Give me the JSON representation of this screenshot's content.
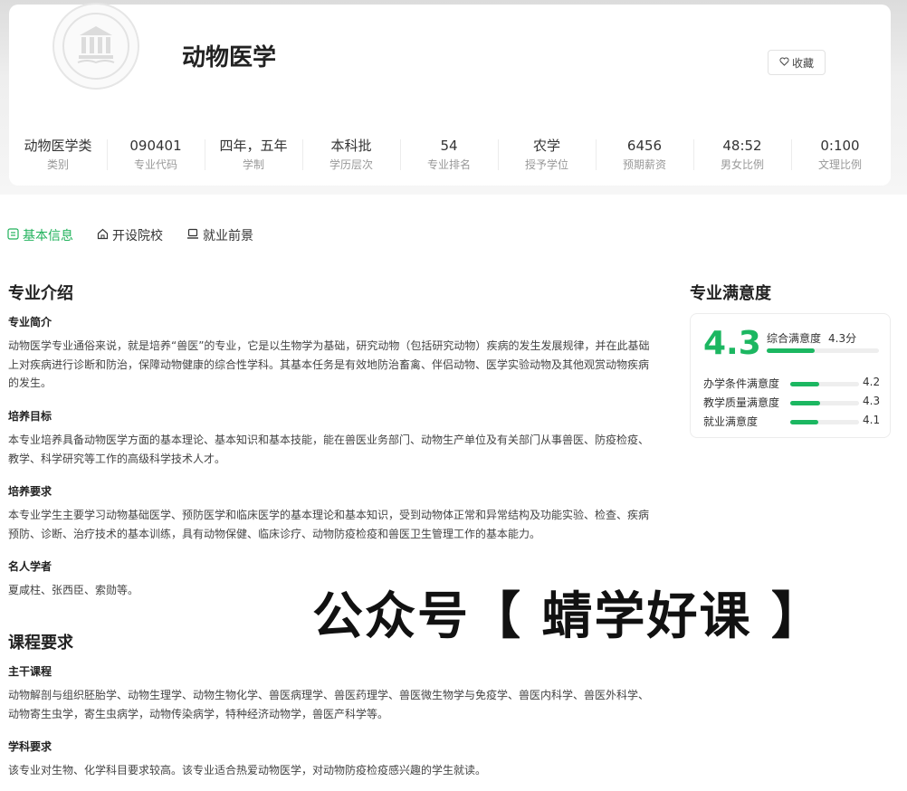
{
  "header": {
    "title": "动物医学",
    "favorite_label": "收藏"
  },
  "stats": [
    {
      "value": "动物医学类",
      "label": "类别"
    },
    {
      "value": "090401",
      "label": "专业代码"
    },
    {
      "value": "四年，五年",
      "label": "学制"
    },
    {
      "value": "本科批",
      "label": "学历层次"
    },
    {
      "value": "54",
      "label": "专业排名"
    },
    {
      "value": "农学",
      "label": "授予学位"
    },
    {
      "value": "6456",
      "label": "预期薪资"
    },
    {
      "value": "48:52",
      "label": "男女比例"
    },
    {
      "value": "0:100",
      "label": "文理比例"
    }
  ],
  "tabs": [
    {
      "label": "基本信息",
      "icon": "document-icon",
      "active": true
    },
    {
      "label": "开设院校",
      "icon": "house-icon",
      "active": false
    },
    {
      "label": "就业前景",
      "icon": "laptop-icon",
      "active": false
    }
  ],
  "intro": {
    "title": "专业介绍",
    "summary_title": "专业简介",
    "summary_text": "动物医学专业通俗来说，就是培养“兽医”的专业，它是以生物学为基础，研究动物（包括研究动物）疾病的发生发展规律，并在此基础上对疾病进行诊断和防治，保障动物健康的综合性学科。其基本任务是有效地防治畜禽、伴侣动物、医学实验动物及其他观赏动物疾病的发生。",
    "goal_title": "培养目标",
    "goal_text": "本专业培养具备动物医学方面的基本理论、基本知识和基本技能，能在兽医业务部门、动物生产单位及有关部门从事兽医、防疫检疫、教学、科学研究等工作的高级科学技术人才。",
    "req_title": "培养要求",
    "req_text": "本专业学生主要学习动物基础医学、预防医学和临床医学的基本理论和基本知识，受到动物体正常和异常结构及功能实验、检查、疾病预防、诊断、治疗技术的基本训练，具有动物保健、临床诊疗、动物防疫检疫和兽医卫生管理工作的基本能力。",
    "scholars_title": "名人学者",
    "scholars_text": "夏咸柱、张西臣、索勋等。"
  },
  "courses": {
    "title": "课程要求",
    "main_title": "主干课程",
    "main_text": "动物解剖与组织胚胎学、动物生理学、动物生物化学、兽医病理学、兽医药理学、兽医微生物学与免疫学、兽医内科学、兽医外科学、动物寄生虫学，寄生虫病学，动物传染病学，特种经济动物学，兽医产科学等。",
    "subject_title": "学科要求",
    "subject_text": "该专业对生物、化学科目要求较高。该专业适合热爱动物医学，对动物防疫检疫感兴趣的学生就读。"
  },
  "satisfaction": {
    "title": "专业满意度",
    "overall": "4.3",
    "overall_label": "综合满意度",
    "overall_score": "4.3分",
    "overall_fraction": 0.43,
    "accent_color": "#1cb761",
    "rows": [
      {
        "label": "办学条件满意度",
        "value": "4.2",
        "fraction": 0.42
      },
      {
        "label": "教学质量满意度",
        "value": "4.3",
        "fraction": 0.43
      },
      {
        "label": "就业满意度",
        "value": "4.1",
        "fraction": 0.41
      }
    ]
  },
  "watermark": "公众号【 蜻学好课 】"
}
